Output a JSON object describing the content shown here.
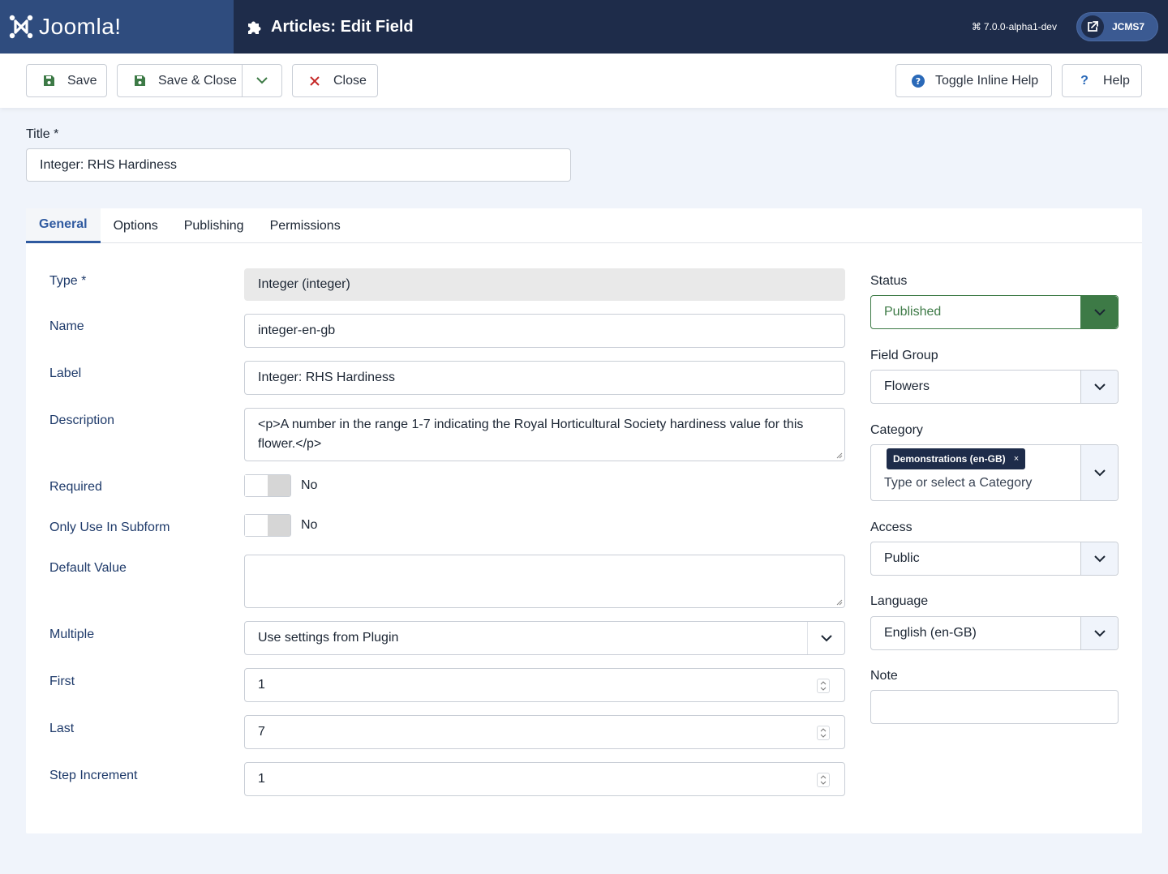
{
  "header": {
    "logo_text": "Joomla!",
    "title": "Articles: Edit Field",
    "version": "7.0.0-alpha1-dev",
    "site_button": "JCMS7"
  },
  "toolbar": {
    "save": "Save",
    "save_close": "Save & Close",
    "close": "Close",
    "toggle_help": "Toggle Inline Help",
    "help": "Help"
  },
  "title_field": {
    "label": "Title *",
    "value": "Integer: RHS Hardiness"
  },
  "tabs": [
    "General",
    "Options",
    "Publishing",
    "Permissions"
  ],
  "general": {
    "type_label": "Type *",
    "type_value": "Integer (integer)",
    "name_label": "Name",
    "name_value": "integer-en-gb",
    "label_label": "Label",
    "label_value": "Integer: RHS Hardiness",
    "description_label": "Description",
    "description_value": "<p>A number in the range 1-7 indicating the Royal Horticultural Society hardiness value for this flower.</p>",
    "required_label": "Required",
    "required_value": "No",
    "subform_label": "Only Use In Subform",
    "subform_value": "No",
    "default_label": "Default Value",
    "default_value": "",
    "multiple_label": "Multiple",
    "multiple_value": "Use settings from Plugin",
    "first_label": "First",
    "first_value": "1",
    "last_label": "Last",
    "last_value": "7",
    "step_label": "Step Increment",
    "step_value": "1"
  },
  "sidebar": {
    "status_label": "Status",
    "status_value": "Published",
    "group_label": "Field Group",
    "group_value": "Flowers",
    "category_label": "Category",
    "category_chip": "Demonstrations (en-GB)",
    "category_chip_remove": "×",
    "category_placeholder": "Type or select a Category",
    "access_label": "Access",
    "access_value": "Public",
    "language_label": "Language",
    "language_value": "English (en-GB)",
    "note_label": "Note",
    "note_value": ""
  },
  "colors": {
    "header_bg": "#1e2c4a",
    "logo_bg": "#2f4c7e",
    "accent": "#2f5aa0",
    "published": "#3d7a46",
    "close_red": "#c52827"
  }
}
